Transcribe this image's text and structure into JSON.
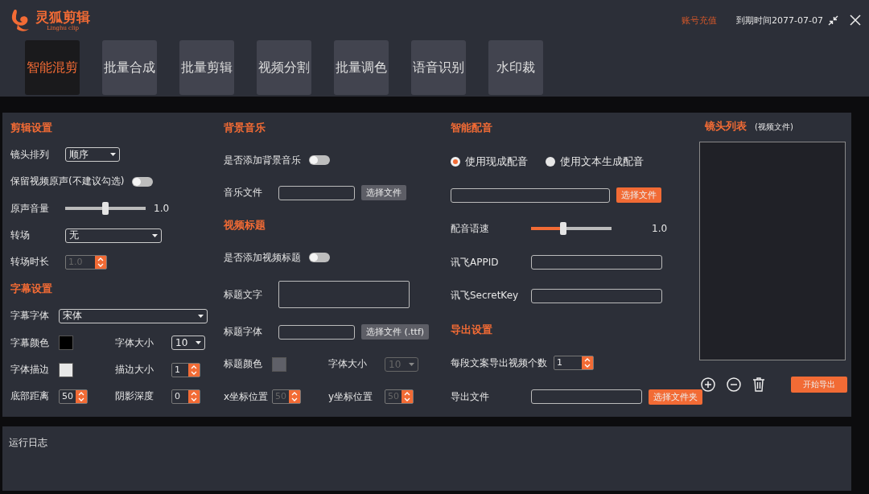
{
  "header": {
    "logo_title": "灵狐剪辑",
    "logo_subtitle": "Linghu clip",
    "recharge": "账号充值",
    "expiry": "到期时间2077-07-07"
  },
  "tabs": [
    {
      "label": "智能混剪",
      "selected": true
    },
    {
      "label": "批量合成",
      "selected": false
    },
    {
      "label": "批量剪辑",
      "selected": false
    },
    {
      "label": "视频分割",
      "selected": false
    },
    {
      "label": "批量调色",
      "selected": false
    },
    {
      "label": "语音识别",
      "selected": false
    },
    {
      "label": "水印裁",
      "selected": false
    }
  ],
  "columns": [
    {
      "rows": [
        {
          "kind": "heading",
          "text": "剪辑设置"
        },
        {
          "kind": "dropdown",
          "label": "镜头排列",
          "value": "顺序"
        },
        {
          "kind": "toggle",
          "label": "保留视频原声(不建议勾选)",
          "on": false
        },
        {
          "kind": "slider",
          "label": "原声音量",
          "level": 0.5,
          "reading": "1.0",
          "disabled": true
        },
        {
          "kind": "dropdown",
          "label": "转场",
          "value": "无"
        },
        {
          "kind": "spin",
          "label": "转场时长",
          "value": "1.0",
          "disabled": true
        },
        {
          "kind": "heading",
          "text": "字幕设置"
        },
        {
          "kind": "dropdown",
          "label": "字幕字体",
          "value": "宋体"
        },
        {
          "kind": "pair",
          "items": [
            {
              "kind": "color",
              "label": "字幕颜色",
              "color": "#000000"
            },
            {
              "kind": "dropdown",
              "label": "字体大小",
              "value": "10"
            }
          ]
        },
        {
          "kind": "pair",
          "items": [
            {
              "kind": "color",
              "label": "字体描边",
              "color": "#e8e8e8"
            },
            {
              "kind": "spin",
              "label": "描边大小",
              "value": "1",
              "disabled": false
            }
          ]
        },
        {
          "kind": "pair",
          "items": [
            {
              "kind": "spin",
              "label": "底部距离",
              "value": "50",
              "disabled": false
            },
            {
              "kind": "spin",
              "label": "阴影深度",
              "value": "0",
              "disabled": false
            }
          ]
        }
      ]
    },
    {
      "rows": [
        {
          "kind": "heading",
          "text": "背景音乐"
        },
        {
          "kind": "toggle",
          "label": "是否添加背景音乐",
          "on": false
        },
        {
          "kind": "file",
          "label": "音乐文件",
          "button": "选择文件"
        },
        {
          "kind": "heading",
          "text": "视频标题"
        },
        {
          "kind": "toggle",
          "label": "是否添加视频标题",
          "on": false
        },
        {
          "kind": "textarea",
          "label": "标题文字"
        },
        {
          "kind": "file",
          "label": "标题字体",
          "button": "选择文件 (.ttf)"
        },
        {
          "kind": "pair",
          "items": [
            {
              "kind": "color",
              "label": "标题颜色",
              "color": "#5f6068"
            },
            {
              "kind": "dropdown",
              "label": "字体大小",
              "value": "10",
              "disabled": true
            }
          ]
        },
        {
          "kind": "pair",
          "items": [
            {
              "kind": "spin",
              "label": "x坐标位置",
              "value": "50",
              "disabled": true
            },
            {
              "kind": "spin",
              "label": "y坐标位置",
              "value": "50",
              "disabled": true
            }
          ]
        }
      ]
    },
    {
      "rows": [
        {
          "kind": "heading",
          "text": "智能配音"
        },
        {
          "kind": "radios",
          "options": [
            {
              "label": "使用现成配音",
              "selected": true
            },
            {
              "label": "使用文本生成配音",
              "selected": false
            }
          ]
        },
        {
          "kind": "file",
          "button": "选择文件"
        },
        {
          "kind": "slider",
          "label": "配音语速",
          "level": 0.4,
          "reading": "1.0",
          "disabled": false
        },
        {
          "kind": "input",
          "label": "讯飞APPID"
        },
        {
          "kind": "input",
          "label": "讯飞SecretKey"
        },
        {
          "kind": "heading",
          "text": "导出设置"
        },
        {
          "kind": "spin",
          "label": "每段文案导出视频个数",
          "value": "1",
          "disabled": false
        },
        {
          "kind": "file",
          "label": "导出文件",
          "button": "选择文件夹"
        }
      ]
    }
  ],
  "clip_list": {
    "title": "镜头列表",
    "subtitle": "(视频文件)",
    "export_button": "开始导出"
  },
  "log": {
    "title": "运行日志"
  }
}
